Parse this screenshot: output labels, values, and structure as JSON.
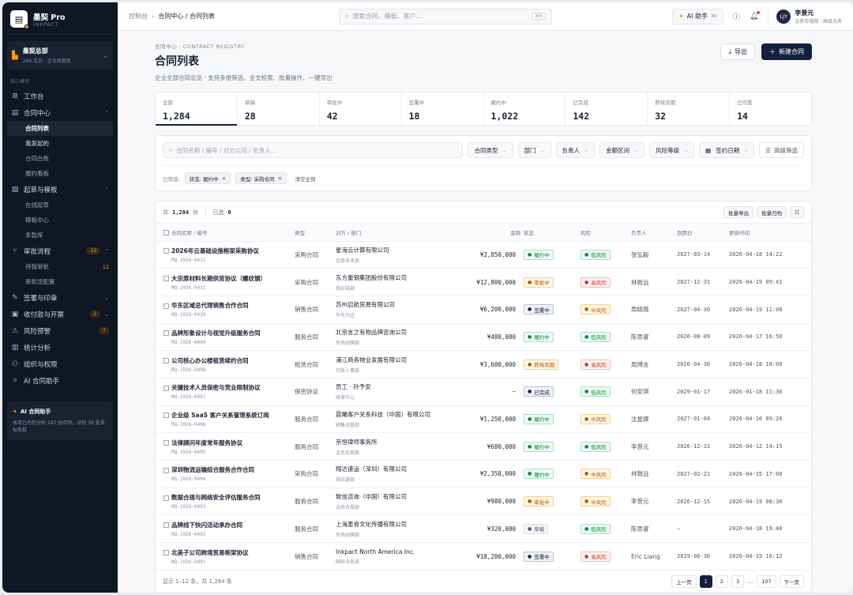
{
  "brand": {
    "name": "墨契 Pro",
    "sub": "INKPACT"
  },
  "org": {
    "name": "墨契总部",
    "sub": "286 成员 · 企业旗舰版"
  },
  "sidebar": {
    "section_label": "核心模块",
    "workbench": "工作台",
    "contract_center": "合同中心",
    "contract_sub": [
      "合同列表",
      "我发起的",
      "合同台账",
      "履约看板"
    ],
    "draft": "起草与模板",
    "draft_sub": [
      "在线起草",
      "模板中心",
      "条款库"
    ],
    "approval": "审批流程",
    "approval_badge": "12",
    "approval_sub": [
      "待我审批",
      "审批流配置"
    ],
    "approval_sub_badge": "12",
    "sign": "签署与印章",
    "payment": "收付款与开票",
    "payment_badge": "1",
    "risk": "风险预警",
    "risk_badge": "7",
    "stats": "统计分析",
    "org_perm": "组织与权限",
    "ai": "AI 合同助手"
  },
  "ai_card": {
    "title": "AI 合同助手",
    "text": "本月已为您分析 247 份合同，识别 38 处非标条款"
  },
  "topbar": {
    "crumb_root": "控制台",
    "crumb_path": "合同中心 / 合同列表",
    "search_placeholder": "搜索合同、模板、客户...",
    "search_kbd": "⌘K",
    "ai_btn": "AI 助手",
    "ai_kbd": "⌘J",
    "user_initials": "LJY",
    "user_name": "李景元",
    "user_role": "法务合规部 · 高级法务"
  },
  "page": {
    "eyebrow": "合同中心 · CONTRACT REGISTRY",
    "title": "合同列表",
    "desc": "企业全部合同总览 · 支持多维筛选、全文检索、批量操作、一键导出",
    "export_btn": "导出",
    "new_btn": "新建合同"
  },
  "stats": [
    {
      "label": "全部",
      "value": "1,284"
    },
    {
      "label": "草稿",
      "value": "28"
    },
    {
      "label": "审批中",
      "value": "42"
    },
    {
      "label": "签署中",
      "value": "18"
    },
    {
      "label": "履约中",
      "value": "1,022"
    },
    {
      "label": "已完成",
      "value": "142"
    },
    {
      "label": "即将到期",
      "value": "32"
    },
    {
      "label": "已作废",
      "value": "14"
    }
  ],
  "filters": {
    "search_placeholder": "合同名称 / 编号 / 对方公司 / 负责人...",
    "selects": [
      "合同类型",
      "部门",
      "负责人",
      "金额区间",
      "风险等级"
    ],
    "date": "签约日期",
    "advanced": "高级筛选",
    "chips_label": "已筛选:",
    "chips": [
      "状态: 履约中",
      "类型: 采购合同"
    ],
    "clear": "清空全部"
  },
  "table": {
    "total_prefix": "共",
    "total": "1,284",
    "total_suffix": "份",
    "selected_prefix": "已选",
    "selected": "0",
    "batch_export": "批量导出",
    "batch_archive": "批量归档",
    "columns": [
      "合同名称 / 编号",
      "类型",
      "对方 / 部门",
      "金额",
      "状态",
      "风险",
      "负责人",
      "到期日",
      "更新时间"
    ],
    "rows": [
      {
        "name": "2026年云基础设施框架采购协议",
        "code": "MQ-2026-0412",
        "type": "采购合同",
        "cp": "星海云计算有限公司",
        "dept": "信息技术部",
        "amount": "¥2,850,000",
        "status": "履约中",
        "status_style": "green",
        "risk": "低风险",
        "risk_style": "green",
        "owner": "张弘毅",
        "due": "2027-03-14",
        "updated": "2026-04-18 14:22"
      },
      {
        "name": "大宗原材料长期供货协议（螺纹钢）",
        "code": "MQ-2026-0411",
        "type": "采购合同",
        "cp": "东方重钢集团股份有限公司",
        "dept": "供应链部",
        "amount": "¥12,800,000",
        "status": "审批中",
        "status_style": "amber",
        "risk": "高风险",
        "risk_style": "red",
        "owner": "林致远",
        "due": "2027-12-31",
        "updated": "2026-04-19 09:41"
      },
      {
        "name": "华东区域总代理销售合作合同",
        "code": "MQ-2026-0410",
        "type": "销售合同",
        "cp": "苏州启航贸易有限公司",
        "dept": "华东大区",
        "amount": "¥6,200,000",
        "status": "签署中",
        "status_style": "navy",
        "risk": "中风险",
        "risk_style": "amber",
        "owner": "周晓薇",
        "due": "2027-04-30",
        "updated": "2026-04-19 11:08"
      },
      {
        "name": "品牌形象设计与视觉升级服务合同",
        "code": "MQ-2026-0409",
        "type": "服务合同",
        "cp": "北京言之有物品牌咨询公司",
        "dept": "市场品牌部",
        "amount": "¥480,000",
        "status": "履约中",
        "status_style": "green",
        "risk": "低风险",
        "risk_style": "green",
        "owner": "陈思睿",
        "due": "2026-08-09",
        "updated": "2026-04-17 16:50"
      },
      {
        "name": "公司核心办公楼租赁续约合同",
        "code": "MQ-2026-0408",
        "type": "租赁合同",
        "cp": "浦江商务物业发展有限公司",
        "dept": "行政人事部",
        "amount": "¥3,600,000",
        "status": "即将到期",
        "status_style": "amber",
        "risk": "高风险",
        "risk_style": "red",
        "owner": "周博言",
        "due": "2026-04-30",
        "updated": "2026-04-18 10:00"
      },
      {
        "name": "关键技术人员保密与竞业限制协议",
        "code": "MQ-2026-0407",
        "type": "保密协议",
        "cp": "员工 · 孙予安",
        "dept": "研发中心",
        "amount": "—",
        "status": "已完成",
        "status_style": "navy",
        "risk": "低风险",
        "risk_style": "green",
        "owner": "何安琪",
        "due": "2029-01-17",
        "updated": "2026-01-18 11:30"
      },
      {
        "name": "企业级 SaaS 客户关系管理系统订阅",
        "code": "MQ-2026-0406",
        "type": "服务合同",
        "cp": "晨曦客户关系科技（中国）有限公司",
        "dept": "销售运营部",
        "amount": "¥1,250,000",
        "status": "履约中",
        "status_style": "green",
        "risk": "中风险",
        "risk_style": "amber",
        "owner": "沈星卿",
        "due": "2027-01-04",
        "updated": "2026-04-16 09:20"
      },
      {
        "name": "法律顾问年度常年服务协议",
        "code": "MQ-2026-0405",
        "type": "服务合同",
        "cp": "京恒律师事务所",
        "dept": "法务合规部",
        "amount": "¥680,000",
        "status": "履约中",
        "status_style": "green",
        "risk": "低风险",
        "risk_style": "green",
        "owner": "李景元",
        "due": "2026-12-31",
        "updated": "2026-04-12 14:15"
      },
      {
        "name": "深圳物流运输综合服务合作合同",
        "code": "MQ-2026-0404",
        "type": "采购合同",
        "cp": "翔达速运（深圳）有限公司",
        "dept": "供应链部",
        "amount": "¥2,350,000",
        "status": "履约中",
        "status_style": "green",
        "risk": "中风险",
        "risk_style": "amber",
        "owner": "林致远",
        "due": "2027-02-21",
        "updated": "2026-04-15 17:00"
      },
      {
        "name": "数据合规与网络安全评估服务合同",
        "code": "MQ-2026-0403",
        "type": "服务合同",
        "cp": "致信咨询（中国）有限公司",
        "dept": "法务合规部",
        "amount": "¥980,000",
        "status": "审批中",
        "status_style": "amber",
        "risk": "中风险",
        "risk_style": "amber",
        "owner": "李景元",
        "due": "2026-12-15",
        "updated": "2026-04-19 08:30"
      },
      {
        "name": "品牌线下快闪活动承办合同",
        "code": "MQ-2026-0402",
        "type": "服务合同",
        "cp": "上海墨青文化传播有限公司",
        "dept": "市场品牌部",
        "amount": "¥320,000",
        "status": "草稿",
        "status_style": "gray",
        "risk": "低风险",
        "risk_style": "green",
        "owner": "陈思睿",
        "due": "—",
        "updated": "2026-04-18 19:40"
      },
      {
        "name": "北美子公司跨境贸易框架协议",
        "code": "MQ-2026-0401",
        "type": "销售合同",
        "cp": "Inkpact North America Inc.",
        "dept": "国际业务部",
        "amount": "¥18,200,000",
        "status": "签署中",
        "status_style": "navy",
        "risk": "高风险",
        "risk_style": "red",
        "owner": "Eric Liang",
        "due": "2029-06-30",
        "updated": "2026-04-19 10:12"
      }
    ]
  },
  "pager": {
    "summary": "显示 1–12 条，共 1,284 条",
    "prev": "上一页",
    "pages": [
      "1",
      "2",
      "3",
      "…",
      "107"
    ],
    "next": "下一页"
  }
}
